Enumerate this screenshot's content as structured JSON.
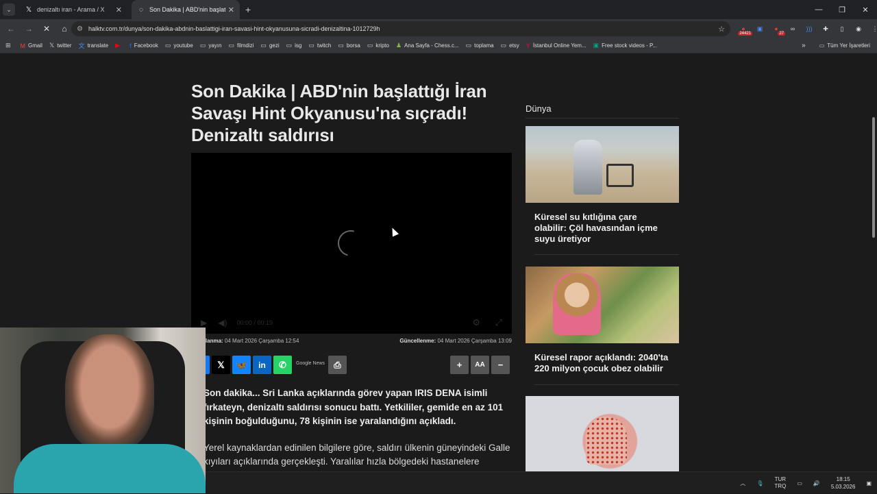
{
  "browser": {
    "tabs": [
      {
        "title": "denizaltı iran - Arama / X",
        "icon": "x-logo-icon",
        "active": false
      },
      {
        "title": "Son Dakika | ABD'nin başlattığı",
        "icon": "loading-icon",
        "active": true
      }
    ],
    "url": "halktv.com.tr/dunya/son-dakika-abdnin-baslattigi-iran-savasi-hint-okyanusuna-sicradi-denizaltina-1012729h",
    "extension_badges": {
      "first": "24421",
      "second": "27"
    },
    "bookmarks": [
      {
        "label": "Gmail",
        "icon": "gmail-icon"
      },
      {
        "label": "twitter",
        "icon": "x-logo-icon"
      },
      {
        "label": "translate",
        "icon": "translate-icon"
      },
      {
        "label": "",
        "icon": "youtube-icon"
      },
      {
        "label": "Facebook",
        "icon": "facebook-icon"
      },
      {
        "label": "youtube",
        "icon": "folder-icon"
      },
      {
        "label": "yayın",
        "icon": "folder-icon"
      },
      {
        "label": "filmdizi",
        "icon": "folder-icon"
      },
      {
        "label": "gezi",
        "icon": "folder-icon"
      },
      {
        "label": "isg",
        "icon": "folder-icon"
      },
      {
        "label": "twitch",
        "icon": "folder-icon"
      },
      {
        "label": "borsa",
        "icon": "folder-icon"
      },
      {
        "label": "kripto",
        "icon": "folder-icon"
      },
      {
        "label": "Ana Sayfa - Chess.c...",
        "icon": "chess-icon"
      },
      {
        "label": "toplama",
        "icon": "folder-icon"
      },
      {
        "label": "etsy",
        "icon": "folder-icon"
      },
      {
        "label": "İstanbul Online Yem...",
        "icon": "yemeksepeti-icon"
      },
      {
        "label": "Free stock videos - P...",
        "icon": "pexels-icon"
      }
    ],
    "all_bookmarks": "Tüm Yer İşaretleri"
  },
  "article": {
    "title": "Son Dakika | ABD'nin başlattığı İran Savaşı Hint Okyanusu'na sıçradı! Denizaltı saldırısı",
    "video_time": "00:00 / 00:19",
    "published_label": "Yayınlanma:",
    "published": "04 Mart 2026 Çarşamba 12:54",
    "updated_label": "Güncellenme:",
    "updated": "04 Mart 2026 Çarşamba 13:09",
    "google_news": "Google News",
    "lead": "Son dakika... Sri Lanka açıklarında görev yapan IRIS DENA isimli fırkateyn, denizaltı saldırısı sonucu battı. Yetkililer, gemide en az 101 kişinin boğulduğunu, 78 kişinin ise yaralandığını açıkladı.",
    "paragraph_1": "Yerel kaynaklardan edinilen bilgilere göre, saldırı ülkenin güneyindeki Galle kıyıları açıklarında gerçekleşti. Yaralılar hızla bölgedeki hastanelere kaldırılırken, kurtarma çalışmaları sürdüğü belirtildi. Saldırının kim tarafından gerçekleştirildiği ve"
  },
  "sidebar": {
    "section": "Dünya",
    "cards": [
      {
        "title": "Küresel su kıtlığına çare olabilir: Çöl havasından içme suyu üretiyor"
      },
      {
        "title": "Küresel rapor açıklandı: 2040'ta 220 milyon çocuk obez olabilir"
      },
      {
        "title": ""
      }
    ]
  },
  "taskbar": {
    "lang_top": "TUR",
    "lang_bottom": "TRQ",
    "time": "18:15",
    "date": "5.03.2026"
  }
}
